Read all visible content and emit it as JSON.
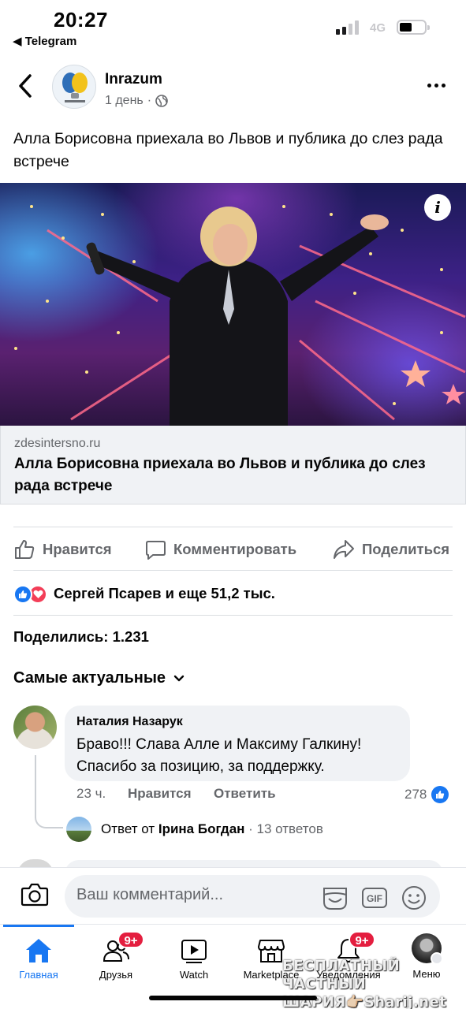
{
  "status_bar": {
    "time": "20:27",
    "back_app": "◀ Telegram",
    "network": "4G"
  },
  "post": {
    "page_name": "Inrazum",
    "time_ago": "1 день",
    "text": "Алла Борисовна приехала во Львов и публика до слез рада встрече",
    "link": {
      "domain": "zdesintersno.ru",
      "title": "Алла Борисовна приехала во Львов и публика до слез рада встрече"
    }
  },
  "actions": {
    "like": "Нравится",
    "comment": "Комментировать",
    "share": "Поделиться"
  },
  "reactions": {
    "summary": "Сергей Псарев и еще 51,2 тыс.",
    "shares": "Поделились: 1.231"
  },
  "comments": {
    "sort_label": "Самые актуальные",
    "items": [
      {
        "author": "Наталия Назарук",
        "text": "Браво!!!  Слава Алле и Максиму Галкину! Спасибо за позицию, за поддержку.",
        "time": "23 ч.",
        "like_label": "Нравится",
        "reply_label": "Ответить",
        "likes": "278",
        "reply_prefix": "Ответ от",
        "reply_author": "Ірина Богдан",
        "reply_count": "· 13 ответов"
      }
    ]
  },
  "composer": {
    "placeholder": "Ваш комментарий..."
  },
  "tabs": [
    {
      "label": "Главная",
      "badge": ""
    },
    {
      "label": "Друзья",
      "badge": "9+"
    },
    {
      "label": "Watch",
      "badge": ""
    },
    {
      "label": "Marketplace",
      "badge": ""
    },
    {
      "label": "Уведомления",
      "badge": "9+"
    },
    {
      "label": "Меню",
      "badge": ""
    }
  ],
  "watermark": {
    "line1": "БЕСПЛАТНЫЙ ЧАСТНЫЙ",
    "line2": "ШАРИЯ👉🏻Sharij.net"
  },
  "colors": {
    "accent": "#1877f2",
    "badge": "#e41e3f",
    "love": "#f33e58",
    "secondary_text": "#65676b"
  }
}
